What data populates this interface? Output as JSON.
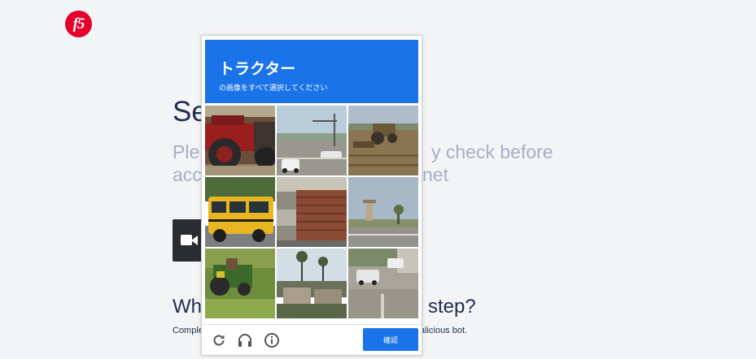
{
  "page": {
    "logo_text": "f5",
    "headline": "Se",
    "subline1_left": "Ple",
    "subline1_right": "y check before",
    "subline2_left": "acc",
    "subline2_right": "net",
    "question_left": "Wh",
    "question_right": "e step?",
    "small_left": "Comple",
    "small_right": "alicious bot."
  },
  "captcha": {
    "title": "トラクター",
    "subtitle": "の画像をすべて選択してください",
    "verify_label": "確認",
    "accent_color": "#1a73e8",
    "tiles": [
      "red-tractor",
      "street-intersection",
      "tractor-dirt-field",
      "yellow-bus",
      "brick-wall",
      "roadside-sign",
      "green-tractor-grass",
      "palm-trees-houses",
      "street-cars"
    ],
    "footer_icons": [
      "reload-icon",
      "headphones-icon",
      "info-icon"
    ]
  }
}
